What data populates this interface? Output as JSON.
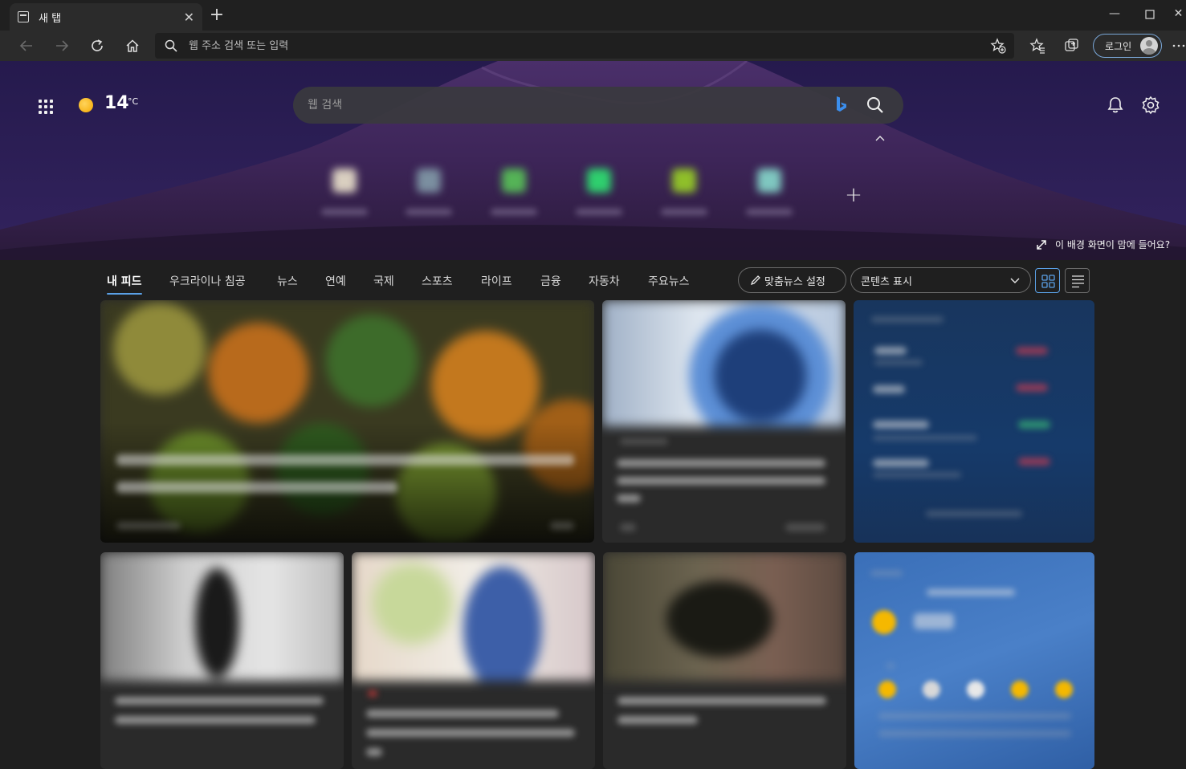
{
  "browser": {
    "tab_title": "새 탭",
    "address_placeholder": "웹 주소 검색 또는 입력",
    "login_label": "로그인"
  },
  "hero": {
    "weather_temp": "14",
    "weather_unit": "°C",
    "search_placeholder": "웹 검색",
    "bg_feedback": "이 배경 화면이 맘에 들어요?"
  },
  "feed": {
    "tabs": [
      "내 피드",
      "우크라이나 침공",
      "뉴스",
      "연예",
      "국제",
      "스포츠",
      "라이프",
      "금융",
      "자동차",
      "주요뉴스"
    ],
    "personalize_label": "맞춤뉴스 설정",
    "content_select_value": "콘텐츠 표시"
  },
  "icons": {
    "tab": "tab-page-icon",
    "back": "back-arrow-icon",
    "forward": "forward-arrow-icon",
    "refresh": "refresh-icon",
    "home": "home-icon",
    "search": "search-icon",
    "add_favorite": "add-favorite-icon",
    "favorites": "favorites-icon",
    "collections": "collections-icon",
    "more": "more-icon",
    "apps": "apps-grid-icon",
    "weather": "sun-icon",
    "bing": "bing-icon",
    "notifications": "bell-icon",
    "settings": "gear-icon",
    "expand": "expand-icon"
  },
  "colors": {
    "accent": "#5aa0e6",
    "hero_purple": "#3a2569",
    "page_bg": "#1f1f1f"
  }
}
